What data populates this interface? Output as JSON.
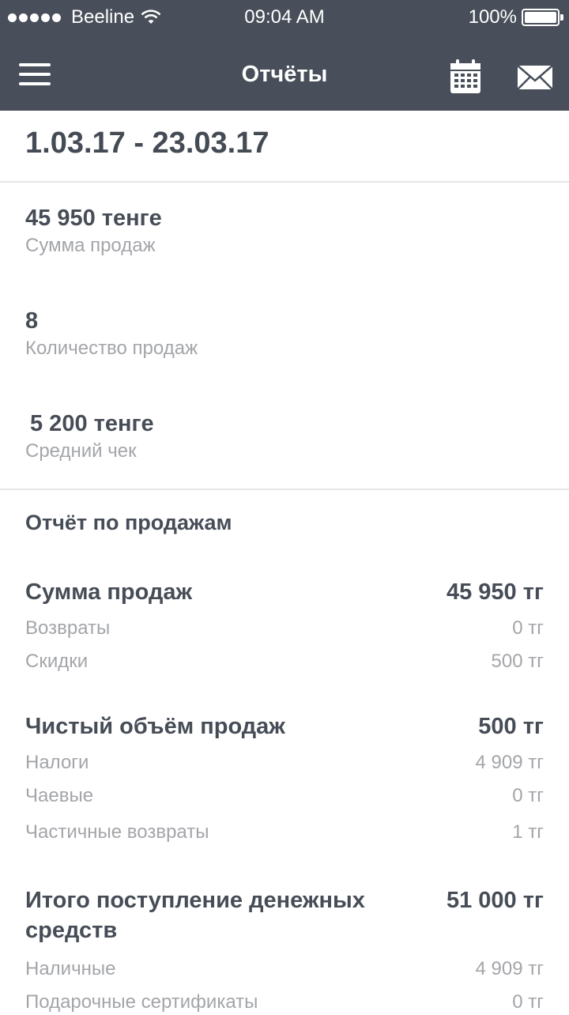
{
  "status_bar": {
    "carrier": "Beeline",
    "time": "09:04 AM",
    "battery": "100%",
    "battery_level": 1.0
  },
  "navbar": {
    "title": "Отчёты",
    "icons": [
      "menu-icon",
      "calendar-icon",
      "mail-icon"
    ]
  },
  "date_range": "1.03.17 - 23.03.17",
  "kpis": [
    {
      "value": "45 950 тенге",
      "label": "Сумма продаж"
    },
    {
      "value": "8",
      "label": "Количество продаж"
    },
    {
      "value": "5 200 тенге",
      "label": "Средний чек"
    }
  ],
  "report": {
    "title": "Отчёт по продажам",
    "sales_total": {
      "label": "Сумма продаж",
      "value": "45 950 тг"
    },
    "returns": {
      "label": "Возвраты",
      "value": "0 тг"
    },
    "discounts": {
      "label": "Скидки",
      "value": "500 тг"
    },
    "net_sales": {
      "label": "Чистый объём продаж",
      "value": "500 тг"
    },
    "taxes": {
      "label": "Налоги",
      "value": "4 909 тг"
    },
    "tips": {
      "label": "Чаевые",
      "value": "0 тг"
    },
    "partial_returns": {
      "label": "Частичные возвраты",
      "value": "1 тг"
    },
    "total_cash_in": {
      "label": "Итого поступление денежных средств",
      "value": "51 000 тг"
    },
    "cash": {
      "label": "Наличные",
      "value": "4 909 тг"
    },
    "gift_certificates": {
      "label": "Подарочные сертификаты",
      "value": "0 тг"
    }
  },
  "colors": {
    "header_bg": "#484f5a",
    "text_dark": "#474d57",
    "text_muted": "#a3a5a9",
    "divider": "#e4e5e8"
  }
}
